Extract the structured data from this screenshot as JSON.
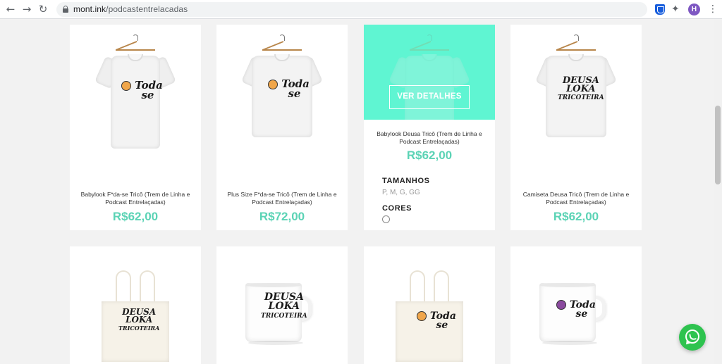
{
  "browser": {
    "url_domain": "mont.ink",
    "url_path": "/podcastentrelacadas",
    "avatar_letter": "H"
  },
  "products_row1": [
    {
      "name": "Babylook F*da-se Tricô (Trem de Linha e Podcast Entrelaçadas)",
      "price": "R$62,00"
    },
    {
      "name": "Plus Size F*da-se Tricô (Trem de Linha e Podcast Entrelaçadas)",
      "price": "R$72,00"
    },
    {
      "name": "Babylook Deusa Tricô (Trem de Linha e Podcast Entrelaçadas)",
      "price": "R$62,00"
    },
    {
      "name": "Camiseta Deusa Tricô (Trem de Linha e Podcast Entrelaçadas)",
      "price": "R$62,00"
    }
  ],
  "hover_card": {
    "button_label": "VER DETALHES",
    "sizes_title": "TAMANHOS",
    "sizes_value": "P, M, G, GG",
    "colors_title": "CORES"
  },
  "art": {
    "deusa_l1": "DEUSA",
    "deusa_l2": "LOKA",
    "deusa_l3": "TRICOTEIRA",
    "toda_l1": "Toda",
    "toda_l2": "se"
  },
  "colors": {
    "accent": "#5bd3b5",
    "hover_overlay": "#5ff5d2",
    "whatsapp": "#2ec34f"
  },
  "icons": [
    "back-icon",
    "forward-icon",
    "reload-icon",
    "lock-icon",
    "star-icon",
    "bitwarden-icon",
    "puzzle-icon",
    "menu-dots-icon",
    "whatsapp-icon"
  ]
}
